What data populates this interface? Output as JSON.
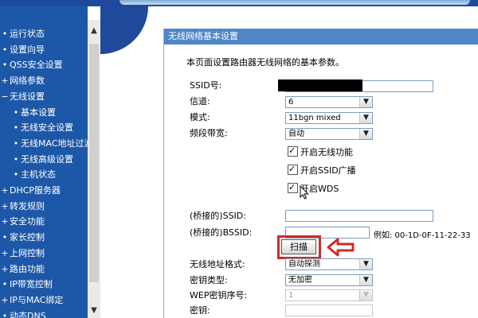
{
  "sidebar": {
    "items": [
      {
        "label": "运行状态",
        "bullet": "•",
        "sub": false
      },
      {
        "label": "设置向导",
        "bullet": "•",
        "sub": false
      },
      {
        "label": "QSS安全设置",
        "bullet": "•",
        "sub": false
      },
      {
        "label": "网络参数",
        "bullet": "+",
        "sub": false
      },
      {
        "label": "无线设置",
        "bullet": "−",
        "sub": false
      },
      {
        "label": "基本设置",
        "bullet": "•",
        "sub": true
      },
      {
        "label": "无线安全设置",
        "bullet": "•",
        "sub": true
      },
      {
        "label": "无线MAC地址过滤",
        "bullet": "•",
        "sub": true
      },
      {
        "label": "无线高级设置",
        "bullet": "•",
        "sub": true
      },
      {
        "label": "主机状态",
        "bullet": "•",
        "sub": true
      },
      {
        "label": "DHCP服务器",
        "bullet": "+",
        "sub": false
      },
      {
        "label": "转发规则",
        "bullet": "+",
        "sub": false
      },
      {
        "label": "安全功能",
        "bullet": "+",
        "sub": false
      },
      {
        "label": "家长控制",
        "bullet": "•",
        "sub": false
      },
      {
        "label": "上网控制",
        "bullet": "+",
        "sub": false
      },
      {
        "label": "路由功能",
        "bullet": "+",
        "sub": false
      },
      {
        "label": "IP带宽控制",
        "bullet": "•",
        "sub": false
      },
      {
        "label": "IP与MAC绑定",
        "bullet": "+",
        "sub": false
      },
      {
        "label": "动态DNS",
        "bullet": "•",
        "sub": false
      }
    ]
  },
  "panel": {
    "title": "无线网络基本设置",
    "description": "本页面设置路由器无线网络的基本参数。",
    "ssid_label": "SSID号:",
    "channel_label": "信道:",
    "channel_value": "6",
    "mode_label": "模式:",
    "mode_value": "11bgn mixed",
    "bandwidth_label": "频段带宽:",
    "bandwidth_value": "自动",
    "checkboxes": [
      {
        "label": "开启无线功能",
        "checked": true
      },
      {
        "label": "开启SSID广播",
        "checked": true
      },
      {
        "label": "开启WDS",
        "checked": true
      }
    ],
    "bridge_ssid_label": "(桥接的)SSID:",
    "bridge_bssid_label": "(桥接的)BSSID:",
    "bssid_example": "例如: 00-1D-0F-11-22-33",
    "scan_label": "扫描",
    "addr_format_label": "无线地址格式:",
    "addr_format_value": "自动探测",
    "key_type_label": "密钥类型:",
    "key_type_value": "无加密",
    "wep_index_label": "WEP密钥序号:",
    "wep_index_value": "1",
    "key_label": "密钥:"
  },
  "colors": {
    "sidebar_bg": "#1d58a8",
    "title_bar": "#4f86c7",
    "highlight_red": "#d12a2a"
  }
}
